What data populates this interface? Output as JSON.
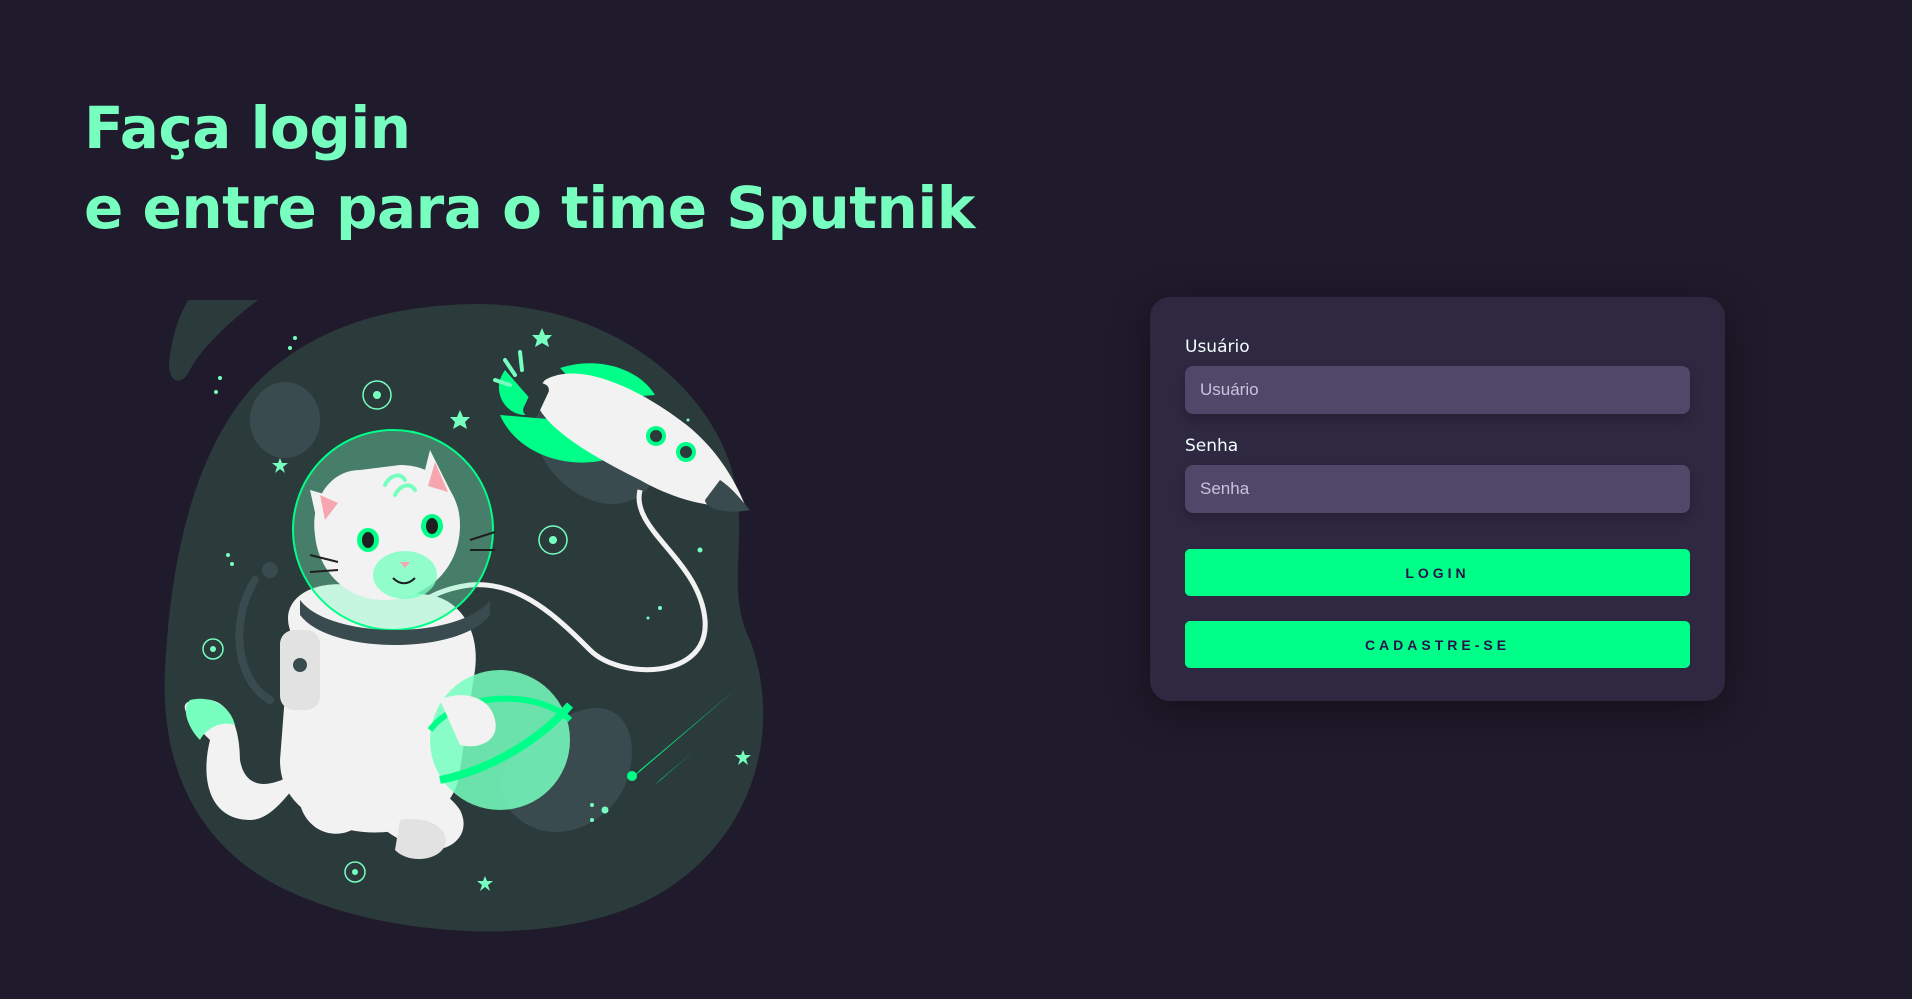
{
  "headline": {
    "line1": "Faça login",
    "line2": "e entre para o time Sputnik"
  },
  "illustration": {
    "icon": "astronaut-cat-icon"
  },
  "form": {
    "username": {
      "label": "Usuário",
      "placeholder": "Usuário"
    },
    "password": {
      "label": "Senha",
      "placeholder": "Senha"
    },
    "login_label": "LOGIN",
    "signup_label": "CADASTRE-SE"
  },
  "colors": {
    "background": "#201b2c",
    "accent": "#77ffc0",
    "button": "#00ff88",
    "card": "#2f2841",
    "input": "#514869"
  }
}
